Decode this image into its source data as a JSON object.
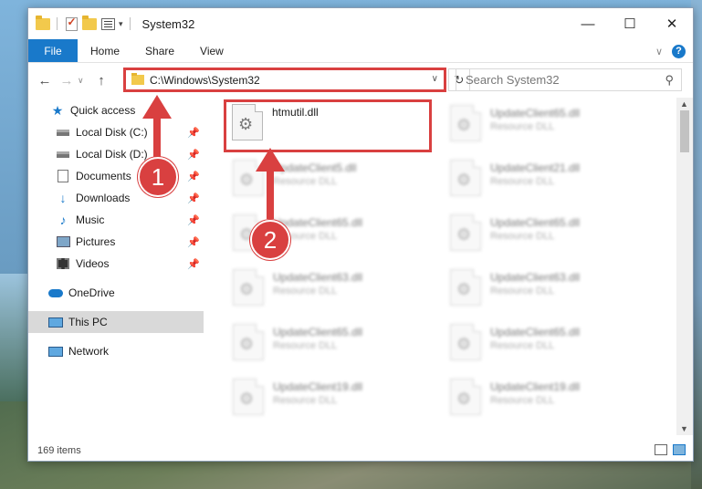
{
  "window": {
    "title": "System32"
  },
  "ribbon": {
    "file": "File",
    "tabs": [
      "Home",
      "Share",
      "View"
    ]
  },
  "address": {
    "path": "C:\\Windows\\System32"
  },
  "search": {
    "placeholder": "Search System32"
  },
  "nav": {
    "items": [
      {
        "label": "Quick access",
        "icon": "star-icon",
        "pinned": false
      },
      {
        "label": "Local Disk (C:)",
        "icon": "drive-icon",
        "pinned": true
      },
      {
        "label": "Local Disk (D:)",
        "icon": "drive-icon",
        "pinned": true
      },
      {
        "label": "Documents",
        "icon": "documents-icon",
        "pinned": true
      },
      {
        "label": "Downloads",
        "icon": "download-icon",
        "pinned": true
      },
      {
        "label": "Music",
        "icon": "music-icon",
        "pinned": true
      },
      {
        "label": "Pictures",
        "icon": "pictures-icon",
        "pinned": true
      },
      {
        "label": "Videos",
        "icon": "videos-icon",
        "pinned": true
      },
      {
        "label": "OneDrive",
        "icon": "onedrive-icon",
        "pinned": false
      },
      {
        "label": "This PC",
        "icon": "this-pc-icon",
        "pinned": false,
        "selected": true
      },
      {
        "label": "Network",
        "icon": "network-icon",
        "pinned": false
      }
    ]
  },
  "files": {
    "highlighted": {
      "name": "htmutil.dll"
    },
    "blurred": [
      {
        "name": "UpdateClient65.dll",
        "type": "Resource DLL"
      },
      {
        "name": "UpdateClient5.dll",
        "type": "Resource DLL"
      },
      {
        "name": "UpdateClient21.dll",
        "type": "Resource DLL"
      },
      {
        "name": "UpdateClient65.dll",
        "type": "Resource DLL"
      },
      {
        "name": "UpdateClient65.dll",
        "type": "Resource DLL"
      },
      {
        "name": "UpdateClient63.dll",
        "type": "Resource DLL"
      },
      {
        "name": "UpdateClient63.dll",
        "type": "Resource DLL"
      },
      {
        "name": "UpdateClient65.dll",
        "type": "Resource DLL"
      },
      {
        "name": "UpdateClient65.dll",
        "type": "Resource DLL"
      },
      {
        "name": "UpdateClient19.dll",
        "type": "Resource DLL"
      },
      {
        "name": "UpdateClient19.dll",
        "type": "Resource DLL"
      }
    ]
  },
  "status": {
    "count": "169 items"
  },
  "annotations": {
    "step1": "1",
    "step2": "2"
  },
  "colors": {
    "accent": "#1979ca",
    "annotation": "#d94040"
  }
}
